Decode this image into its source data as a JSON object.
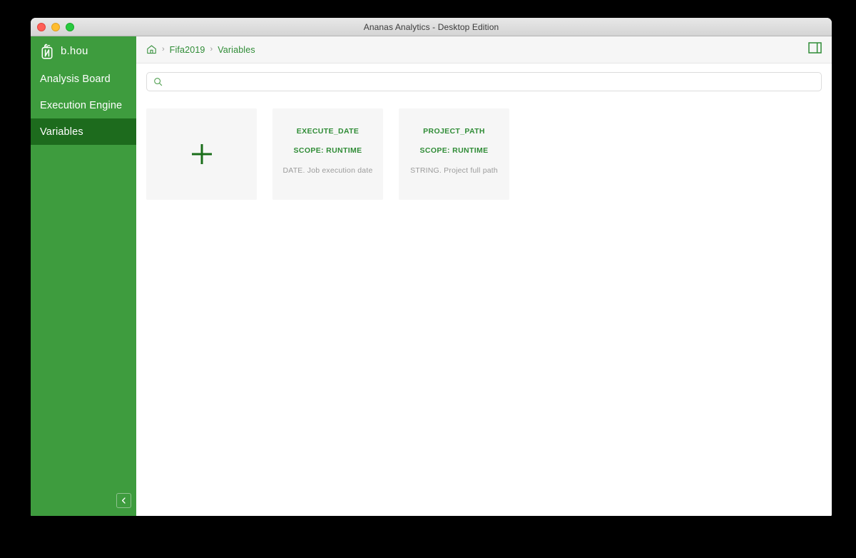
{
  "window": {
    "title": "Ananas Analytics - Desktop Edition",
    "traffic_lights": {
      "close_label": "Close",
      "minimize_label": "Minimize",
      "maximize_label": "Maximize"
    }
  },
  "sidebar": {
    "brand": {
      "icon": "pineapple-logo-icon",
      "name": "b.hou"
    },
    "items": [
      {
        "label": "Analysis Board",
        "active": false
      },
      {
        "label": "Execution Engine",
        "active": false
      },
      {
        "label": "Variables",
        "active": true
      }
    ],
    "collapse_button": {
      "icon": "chevron-left-icon",
      "label": "Collapse sidebar"
    },
    "colors": {
      "background": "#3e9c3e",
      "active_background": "#1d6b1d",
      "text": "#ffffff"
    }
  },
  "breadcrumb": {
    "home_icon": "home-icon",
    "separator": "›",
    "items": [
      {
        "label": "Fifa2019"
      },
      {
        "label": "Variables"
      }
    ],
    "panel_toggle": {
      "icon": "split-panel-icon",
      "label": "Toggle side panel"
    },
    "link_color": "#2f8c36"
  },
  "search": {
    "icon": "search-icon",
    "value": "",
    "placeholder": ""
  },
  "cards": {
    "add_card": {
      "icon": "plus-icon",
      "label": "Add variable"
    },
    "items": [
      {
        "name": "EXECUTE_DATE",
        "scope": "SCOPE: RUNTIME",
        "description": "DATE. Job execution date"
      },
      {
        "name": "PROJECT_PATH",
        "scope": "SCOPE: RUNTIME",
        "description": "STRING. Project full path"
      }
    ],
    "colors": {
      "card_background": "#f6f6f6",
      "title_color": "#2f8c36",
      "description_color": "#9b9b9b"
    }
  }
}
